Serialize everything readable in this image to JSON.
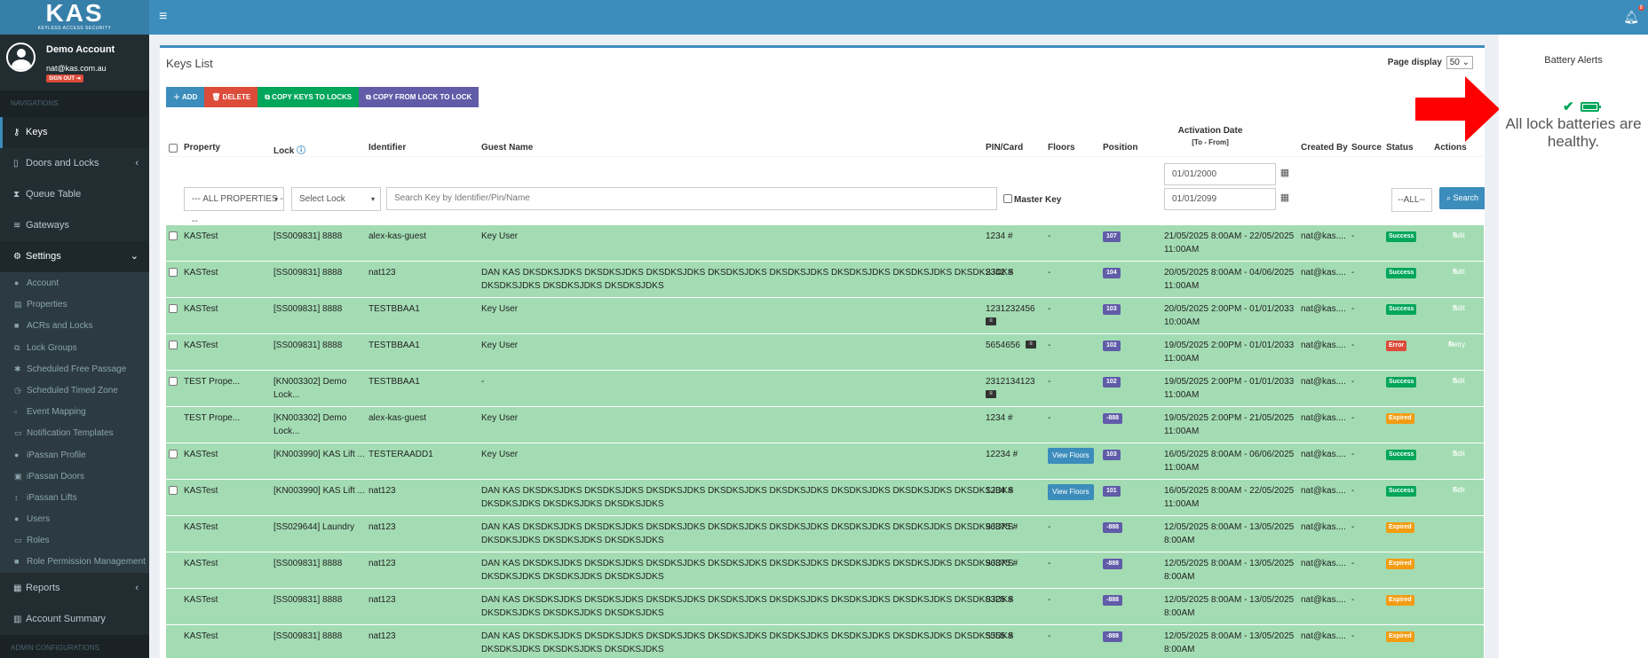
{
  "brand": {
    "name": "KAS",
    "tagline": "KEYLESS ACCESS SECURITY"
  },
  "user": {
    "name": "Demo Account",
    "email": "nat@kas.com.au",
    "signout": "SIGN OUT"
  },
  "sidebar": {
    "section_nav": "NAVIGATIONS",
    "items": [
      {
        "label": "Keys",
        "icon": "key-icon"
      },
      {
        "label": "Doors and Locks",
        "icon": "door-icon"
      },
      {
        "label": "Queue Table",
        "icon": "hourglass-icon"
      },
      {
        "label": "Gateways",
        "icon": "wifi-icon"
      },
      {
        "label": "Settings",
        "icon": "cogs-icon"
      }
    ],
    "settings_sub": [
      {
        "label": "Account",
        "icon": "user-icon"
      },
      {
        "label": "Properties",
        "icon": "building-icon"
      },
      {
        "label": "ACRs and Locks",
        "icon": "lock-icon"
      },
      {
        "label": "Lock Groups",
        "icon": "object-group-icon"
      },
      {
        "label": "Scheduled Free Passage",
        "icon": "asterisk-icon"
      },
      {
        "label": "Scheduled Timed Zone",
        "icon": "clock-icon"
      },
      {
        "label": "Event Mapping",
        "icon": "file-icon"
      },
      {
        "label": "Notification Templates",
        "icon": "file-text-icon"
      },
      {
        "label": "iPassan Profile",
        "icon": "user-cog-icon"
      },
      {
        "label": "iPassan Doors",
        "icon": "square-icon"
      },
      {
        "label": "iPassan Lifts",
        "icon": "arrows-v-icon"
      },
      {
        "label": "Users",
        "icon": "users-icon"
      },
      {
        "label": "Roles",
        "icon": "id-card-icon"
      },
      {
        "label": "Role Permission Management",
        "icon": "lock-icon"
      }
    ],
    "bottom": [
      {
        "label": "Reports",
        "icon": "report-icon"
      },
      {
        "label": "Account Summary",
        "icon": "chart-icon"
      }
    ],
    "section_admin": "ADMIN CONFIGURATIONS"
  },
  "page": {
    "title": "Keys List",
    "page_display_label": "Page display",
    "page_display_value": "50",
    "buttons": {
      "add": "ADD",
      "delete": "DELETE",
      "copy_keys": "COPY KEYS TO LOCKS",
      "copy_lock": "COPY FROM LOCK TO LOCK"
    },
    "columns": {
      "property": "Property",
      "lock": "Lock",
      "identifier": "Identifier",
      "guest": "Guest Name",
      "pin": "PIN/Card",
      "floors": "Floors",
      "position": "Position",
      "activation": "Activation Date",
      "activation_sub": "[To - From]",
      "created": "Created By",
      "source": "Source",
      "status": "Status",
      "actions": "Actions"
    },
    "filters": {
      "property": "--- ALL PROPERTIES ---",
      "lock": "Select Lock",
      "search_placeholder": "Search Key by Identifier/Pin/Name",
      "master_key": "Master Key",
      "date_from": "01/01/2000",
      "date_to": "01/01/2099",
      "status": "--ALL--",
      "search_button": "Search"
    }
  },
  "rows": [
    {
      "checkbox": true,
      "property": "KASTest",
      "lock1": "[SS009831] 8888",
      "lock2": "",
      "identifier": "alex-kas-guest",
      "guest1": "Key User",
      "guest2": "",
      "pin": "1234 #",
      "card": false,
      "floors": "-",
      "viewfloors": false,
      "position": "107",
      "date1": "21/05/2025 8:00AM - 22/05/2025",
      "date2": "11:00AM",
      "created": "nat@kas....",
      "source": "-",
      "status": "Success",
      "action": "Edit"
    },
    {
      "checkbox": true,
      "property": "KASTest",
      "lock1": "[SS009831] 8888",
      "lock2": "",
      "identifier": "nat123",
      "guest1": "DAN KAS DKSDKSJDKS DKSDKSJDKS DKSDKSJDKS DKSDKSJDKS DKSDKSJDKS DKSDKSJDKS DKSDKSJDKS DKSDKSJDKS",
      "guest2": "DKSDKSJDKS DKSDKSJDKS DKSDKSJDKS",
      "pin": "2342 #",
      "card": false,
      "floors": "-",
      "viewfloors": false,
      "position": "104",
      "date1": "20/05/2025 8:00AM - 04/06/2025",
      "date2": "11:00AM",
      "created": "nat@kas....",
      "source": "-",
      "status": "Success",
      "action": "Edit"
    },
    {
      "checkbox": true,
      "property": "KASTest",
      "lock1": "[SS009831] 8888",
      "lock2": "",
      "identifier": "TESTBBAA1",
      "guest1": "Key User",
      "guest2": "",
      "pin": "1231232456",
      "card": true,
      "floors": "-",
      "viewfloors": false,
      "position": "103",
      "date1": "20/05/2025 2:00PM - 01/01/2033",
      "date2": "10:00AM",
      "created": "nat@kas....",
      "source": "-",
      "status": "Success",
      "action": "Edit"
    },
    {
      "checkbox": true,
      "property": "KASTest",
      "lock1": "[SS009831] 8888",
      "lock2": "",
      "identifier": "TESTBBAA1",
      "guest1": "Key User",
      "guest2": "",
      "pin": "5654656",
      "card": true,
      "floors": "-",
      "viewfloors": false,
      "position": "102",
      "date1": "19/05/2025 2:00PM - 01/01/2033",
      "date2": "11:00AM",
      "created": "nat@kas....",
      "source": "-",
      "status": "Error",
      "action": "Retry"
    },
    {
      "checkbox": true,
      "property": "TEST Prope...",
      "lock1": "[KN003302] Demo",
      "lock2": "Lock...",
      "identifier": "TESTBBAA1",
      "guest1": "-",
      "guest2": "",
      "pin": "2312134123",
      "card": true,
      "floors": "-",
      "viewfloors": false,
      "position": "102",
      "date1": "19/05/2025 2:00PM - 01/01/2033",
      "date2": "11:00AM",
      "created": "nat@kas....",
      "source": "-",
      "status": "Success",
      "action": "Edit"
    },
    {
      "checkbox": false,
      "property": "TEST Prope...",
      "lock1": "[KN003302] Demo",
      "lock2": "Lock...",
      "identifier": "alex-kas-guest",
      "guest1": "Key User",
      "guest2": "",
      "pin": "1234 #",
      "card": false,
      "floors": "-",
      "viewfloors": false,
      "position": "-888",
      "date1": "19/05/2025 2:00PM - 21/05/2025",
      "date2": "11:00AM",
      "created": "nat@kas....",
      "source": "-",
      "status": "Expired",
      "action": ""
    },
    {
      "checkbox": true,
      "property": "KASTest",
      "lock1": "[KN003990] KAS Lift ...",
      "lock2": "",
      "identifier": "TESTERAADD1",
      "guest1": "Key User",
      "guest2": "",
      "pin": "12234 #",
      "card": false,
      "floors": "",
      "viewfloors": true,
      "position": "103",
      "date1": "16/05/2025 8:00AM - 06/06/2025",
      "date2": "11:00AM",
      "created": "nat@kas....",
      "source": "-",
      "status": "Success",
      "action": "Edit"
    },
    {
      "checkbox": true,
      "property": "KASTest",
      "lock1": "[KN003990] KAS Lift ...",
      "lock2": "",
      "identifier": "nat123",
      "guest1": "DAN KAS DKSDKSJDKS DKSDKSJDKS DKSDKSJDKS DKSDKSJDKS DKSDKSJDKS DKSDKSJDKS DKSDKSJDKS DKSDKSJDKS",
      "guest2": "DKSDKSJDKS DKSDKSJDKS DKSDKSJDKS",
      "pin": "1234 #",
      "card": false,
      "floors": "",
      "viewfloors": true,
      "position": "101",
      "date1": "16/05/2025 8:00AM - 22/05/2025",
      "date2": "11:00AM",
      "created": "nat@kas....",
      "source": "-",
      "status": "Success",
      "action": "Edit"
    },
    {
      "checkbox": false,
      "property": "KASTest",
      "lock1": "[SS029644] Laundry",
      "lock2": "",
      "identifier": "nat123",
      "guest1": "DAN KAS DKSDKSJDKS DKSDKSJDKS DKSDKSJDKS DKSDKSJDKS DKSDKSJDKS DKSDKSJDKS DKSDKSJDKS DKSDKSJDKS",
      "guest2": "DKSDKSJDKS DKSDKSJDKS DKSDKSJDKS",
      "pin": "96375 #",
      "card": false,
      "floors": "-",
      "viewfloors": false,
      "position": "-888",
      "date1": "12/05/2025 8:00AM - 13/05/2025",
      "date2": "8:00AM",
      "created": "nat@kas....",
      "source": "-",
      "status": "Expired",
      "action": ""
    },
    {
      "checkbox": false,
      "property": "KASTest",
      "lock1": "[SS009831] 8888",
      "lock2": "",
      "identifier": "nat123",
      "guest1": "DAN KAS DKSDKSJDKS DKSDKSJDKS DKSDKSJDKS DKSDKSJDKS DKSDKSJDKS DKSDKSJDKS DKSDKSJDKS DKSDKSJDKS",
      "guest2": "DKSDKSJDKS DKSDKSJDKS DKSDKSJDKS",
      "pin": "96375 #",
      "card": false,
      "floors": "-",
      "viewfloors": false,
      "position": "-888",
      "date1": "12/05/2025 8:00AM - 13/05/2025",
      "date2": "8:00AM",
      "created": "nat@kas....",
      "source": "-",
      "status": "Expired",
      "action": ""
    },
    {
      "checkbox": false,
      "property": "KASTest",
      "lock1": "[SS009831] 8888",
      "lock2": "",
      "identifier": "nat123",
      "guest1": "DAN KAS DKSDKSJDKS DKSDKSJDKS DKSDKSJDKS DKSDKSJDKS DKSDKSJDKS DKSDKSJDKS DKSDKSJDKS DKSDKSJDKS",
      "guest2": "DKSDKSJDKS DKSDKSJDKS DKSDKSJDKS",
      "pin": "0325 #",
      "card": false,
      "floors": "-",
      "viewfloors": false,
      "position": "-888",
      "date1": "12/05/2025 8:00AM - 13/05/2025",
      "date2": "8:00AM",
      "created": "nat@kas....",
      "source": "-",
      "status": "Expired",
      "action": ""
    },
    {
      "checkbox": false,
      "property": "KASTest",
      "lock1": "[SS009831] 8888",
      "lock2": "",
      "identifier": "nat123",
      "guest1": "DAN KAS DKSDKSJDKS DKSDKSJDKS DKSDKSJDKS DKSDKSJDKS DKSDKSJDKS DKSDKSJDKS DKSDKSJDKS DKSDKSJDKS",
      "guest2": "DKSDKSJDKS DKSDKSJDKS DKSDKSJDKS",
      "pin": "5555 #",
      "card": false,
      "floors": "-",
      "viewfloors": false,
      "position": "-888",
      "date1": "12/05/2025 8:00AM - 13/05/2025",
      "date2": "8:00AM",
      "created": "nat@kas....",
      "source": "-",
      "status": "Expired",
      "action": ""
    }
  ],
  "viewfloors_label": "View Floors",
  "battery": {
    "title": "Battery Alerts",
    "message": "All lock batteries are healthy."
  },
  "notifications": {
    "count": "8"
  },
  "colors": {
    "primary": "#3c8dbc",
    "sidebar": "#222d32",
    "row_bg": "#a3dcb3",
    "success": "#00a65a",
    "error": "#dd4b39",
    "expired": "#f39c12",
    "info": "#00c0ef",
    "position": "#605ca8",
    "arrow": "#ff0000"
  }
}
